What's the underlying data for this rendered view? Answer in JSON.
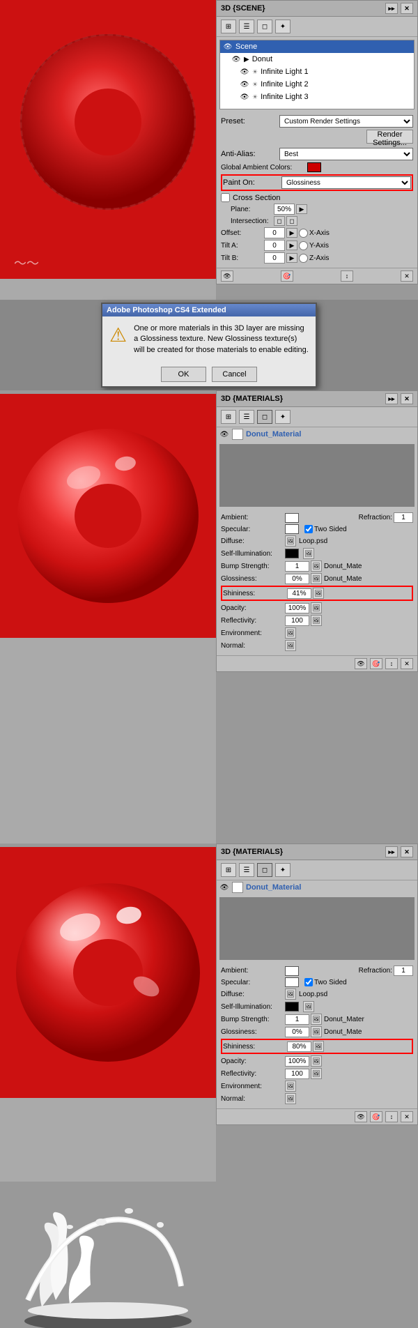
{
  "section1": {
    "panel_title": "3D {SCENE}",
    "toolbar_icons": [
      "grid",
      "stack",
      "box",
      "light"
    ],
    "scene_items": [
      {
        "label": "Scene",
        "type": "scene",
        "level": 0,
        "selected": true
      },
      {
        "label": "Donut",
        "type": "object",
        "level": 1,
        "selected": false
      },
      {
        "label": "Infinite Light 1",
        "type": "light",
        "level": 2,
        "selected": false
      },
      {
        "label": "Infinite Light 2",
        "type": "light",
        "level": 2,
        "selected": false
      },
      {
        "label": "Infinite Light 3",
        "type": "light",
        "level": 2,
        "selected": false
      }
    ],
    "preset_label": "Preset:",
    "preset_value": "Custom Render Settings",
    "render_btn": "Render Settings...",
    "anti_alias_label": "Anti-Alias:",
    "anti_alias_value": "Best",
    "global_ambient_label": "Global Ambient Colors:",
    "paint_on_label": "Paint On:",
    "paint_on_value": "Glossiness",
    "cross_section_label": "Cross Section",
    "plane_label": "Plane:",
    "plane_value": "50%",
    "intersection_label": "Intersection:",
    "offset_label": "Offset:",
    "offset_value": "0",
    "tilt_a_label": "Tilt A:",
    "tilt_a_value": "0",
    "y_axis_label": "Y-Axis",
    "tilt_b_label": "Tilt B:",
    "tilt_b_value": "0",
    "z_axis_label": "Z-Axis",
    "x_axis_label": "X-Axis"
  },
  "dialog": {
    "title": "Adobe Photoshop CS4 Extended",
    "message": "One or more materials in this 3D layer are missing a Glossiness texture. New Glossiness texture(s) will be created for those materials to enable editing.",
    "ok_label": "OK",
    "cancel_label": "Cancel"
  },
  "section2": {
    "panel_title": "3D {MATERIALS}",
    "material_name": "Donut_Material",
    "ambient_label": "Ambient:",
    "refraction_label": "Refraction:",
    "refraction_value": "1",
    "specular_label": "Specular:",
    "two_sided_label": "Two Sided",
    "diffuse_label": "Diffuse:",
    "diffuse_file": "Loop.psd",
    "self_illum_label": "Self-Illumination:",
    "bump_label": "Bump Strength:",
    "bump_value": "1",
    "bump_file": "Donut_Mate",
    "glossiness_label": "Glossiness:",
    "glossiness_value": "0%",
    "glossiness_file": "Donut_Mate",
    "shininess_label": "Shininess:",
    "shininess_value": "41%",
    "opacity_label": "Opacity:",
    "opacity_value": "100%",
    "reflectivity_label": "Reflectivity:",
    "reflectivity_value": "100",
    "environment_label": "Environment:",
    "normal_label": "Normal:"
  },
  "section3": {
    "panel_title": "3D {MATERIALS}",
    "material_name": "Donut_Material",
    "ambient_label": "Ambient:",
    "refraction_label": "Refraction:",
    "refraction_value": "1",
    "specular_label": "Specular:",
    "two_sided_label": "Two Sided",
    "diffuse_label": "Diffuse:",
    "diffuse_file": "Loop.psd",
    "self_illum_label": "Self-Illumination:",
    "bump_label": "Bump Strength:",
    "bump_value": "1",
    "bump_file": "Donut_Mater",
    "glossiness_label": "Glossiness:",
    "glossiness_value": "0%",
    "glossiness_file": "Donut_Mate",
    "shininess_label": "Shininess:",
    "shininess_value": "80%",
    "opacity_label": "Opacity:",
    "opacity_value": "100%",
    "reflectivity_label": "Reflectivity:",
    "reflectivity_value": "100",
    "environment_label": "Environment:",
    "normal_label": "Normal:"
  }
}
